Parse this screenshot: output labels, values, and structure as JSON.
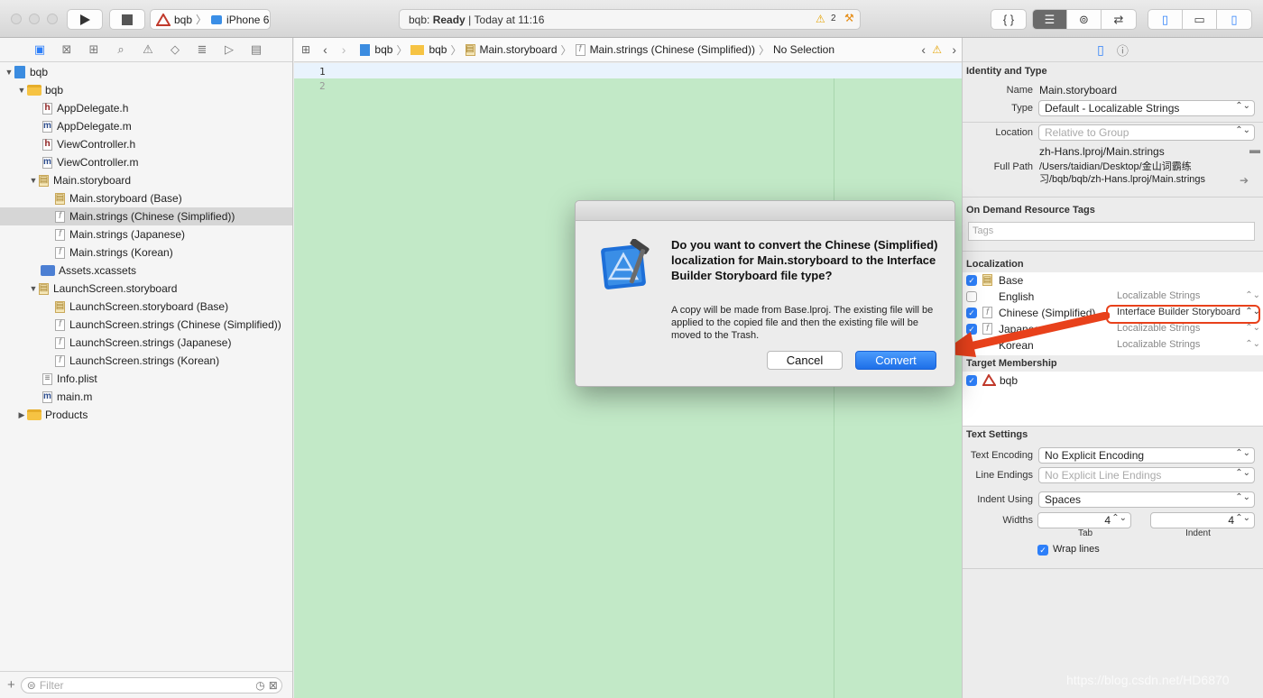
{
  "toolbar": {
    "scheme_project": "bqb",
    "scheme_device": "iPhone 6",
    "status_project": "bqb:",
    "status_state": "Ready",
    "status_sep": "|",
    "status_time": "Today at 11:16",
    "warning_count": "2"
  },
  "navigator": {
    "filter_placeholder": "Filter",
    "items": [
      {
        "label": "bqb"
      },
      {
        "label": "bqb"
      },
      {
        "label": "AppDelegate.h"
      },
      {
        "label": "AppDelegate.m"
      },
      {
        "label": "ViewController.h"
      },
      {
        "label": "ViewController.m"
      },
      {
        "label": "Main.storyboard"
      },
      {
        "label": "Main.storyboard (Base)"
      },
      {
        "label": "Main.strings (Chinese (Simplified))"
      },
      {
        "label": "Main.strings (Japanese)"
      },
      {
        "label": "Main.strings (Korean)"
      },
      {
        "label": "Assets.xcassets"
      },
      {
        "label": "LaunchScreen.storyboard"
      },
      {
        "label": "LaunchScreen.storyboard (Base)"
      },
      {
        "label": "LaunchScreen.strings (Chinese (Simplified))"
      },
      {
        "label": "LaunchScreen.strings (Japanese)"
      },
      {
        "label": "LaunchScreen.strings (Korean)"
      },
      {
        "label": "Info.plist"
      },
      {
        "label": "main.m"
      },
      {
        "label": "Products"
      }
    ]
  },
  "jumpbar": {
    "crumbs": [
      "bqb",
      "bqb",
      "Main.storyboard",
      "Main.strings (Chinese (Simplified))",
      "No Selection"
    ]
  },
  "editor": {
    "lines": [
      "1",
      "2"
    ]
  },
  "inspector": {
    "identity_title": "Identity and Type",
    "name_label": "Name",
    "name_value": "Main.storyboard",
    "type_label": "Type",
    "type_value": "Default - Localizable Strings",
    "location_label": "Location",
    "location_value": "Relative to Group",
    "location_file": "zh-Hans.lproj/Main.strings",
    "fullpath_label": "Full Path",
    "fullpath_value": "/Users/taidian/Desktop/金山词霸练习/bqb/bqb/zh-Hans.lproj/Main.strings",
    "odr_title": "On Demand Resource Tags",
    "tags_placeholder": "Tags",
    "localization_title": "Localization",
    "localizations": [
      {
        "name": "Base",
        "type": ""
      },
      {
        "name": "English",
        "type": "Localizable Strings"
      },
      {
        "name": "Chinese (Simplified)",
        "type": "Interface Builder Storyboard"
      },
      {
        "name": "Japanese",
        "type": "Localizable Strings"
      },
      {
        "name": "Korean",
        "type": "Localizable Strings"
      }
    ],
    "target_title": "Target Membership",
    "target_name": "bqb",
    "text_settings_title": "Text Settings",
    "encoding_label": "Text Encoding",
    "encoding_value": "No Explicit Encoding",
    "line_endings_label": "Line Endings",
    "line_endings_value": "No Explicit Line Endings",
    "indent_using_label": "Indent Using",
    "indent_using_value": "Spaces",
    "widths_label": "Widths",
    "tab_value": "4",
    "indent_value": "4",
    "tab_label": "Tab",
    "indent_label": "Indent",
    "wrap_label": "Wrap lines"
  },
  "dialog": {
    "heading": "Do you want to convert the Chinese (Simplified) localization for Main.storyboard to the Interface Builder Storyboard file type?",
    "body": "A copy will be made from Base.lproj. The existing file will be applied to the copied file and then the existing file will be moved to the Trash.",
    "cancel_label": "Cancel",
    "convert_label": "Convert"
  },
  "watermark": "https://blog.csdn.net/HD6870",
  "colors": {
    "accent": "#2d7ff9",
    "editor_bg": "#c2e9c7",
    "annotation": "#e8411b"
  }
}
